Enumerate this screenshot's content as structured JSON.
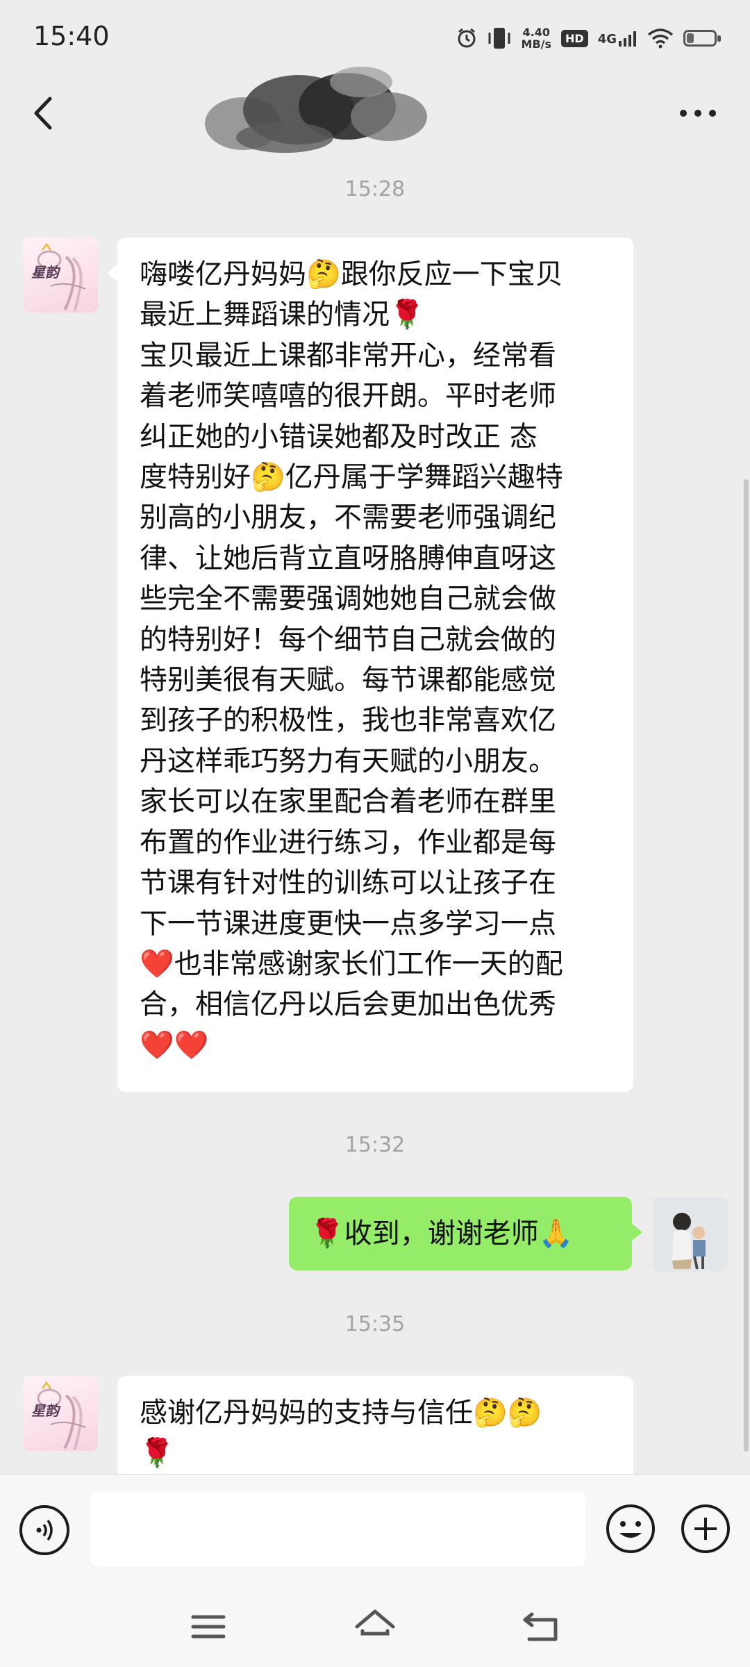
{
  "status_bar": {
    "time": "15:40",
    "net_speed_value": "4.40",
    "net_speed_unit": "MB/s",
    "hd_badge": "HD",
    "network_type": "4G",
    "battery_level_percent": 25
  },
  "header": {
    "contact_name_redacted": true,
    "back_icon": "chevron-left-icon",
    "more_icon": "more-dots-icon"
  },
  "messages": [
    {
      "type": "timestamp",
      "text": "15:28"
    },
    {
      "type": "incoming",
      "avatar": "xingyun-logo-avatar",
      "text": "嗨喽亿丹妈妈🤔跟你反应一下宝贝\n最近上舞蹈课的情况🌹\n宝贝最近上课都非常开心，经常看\n着老师笑嘻嘻的很开朗。平时老师\n纠正她的小错误她都及时改正 态\n度特别好🤔亿丹属于学舞蹈兴趣特\n别高的小朋友，不需要老师强调纪\n律、让她后背立直呀胳膊伸直呀这\n些完全不需要强调她她自己就会做\n的特别好！每个细节自己就会做的\n特别美很有天赋。每节课都能感觉\n到孩子的积极性，我也非常喜欢亿\n丹这样乖巧努力有天赋的小朋友。\n家长可以在家里配合着老师在群里\n布置的作业进行练习，作业都是每\n节课有针对性的训练可以让孩子在\n下一节课进度更快一点多学习一点\n❤️也非常感谢家长们工作一天的配\n合，相信亿丹以后会更加出色优秀\n❤️❤️"
    },
    {
      "type": "timestamp",
      "text": "15:32"
    },
    {
      "type": "outgoing",
      "avatar": "mother-child-photo-avatar",
      "text": "🌹收到，谢谢老师🙏"
    },
    {
      "type": "timestamp",
      "text": "15:35"
    },
    {
      "type": "incoming",
      "avatar": "xingyun-logo-avatar",
      "text": "感谢亿丹妈妈的支持与信任🤔🤔\n🌹"
    }
  ],
  "avatar_logo_text": "星韵",
  "input_bar": {
    "voice_icon": "voice-icon",
    "placeholder": "",
    "emoji_icon": "emoji-icon",
    "plus_icon": "plus-icon"
  },
  "nav_bar": {
    "icons": [
      "menu-icon",
      "home-icon",
      "back-icon"
    ]
  },
  "colors": {
    "background": "#ededed",
    "outgoing_bubble": "#95ec69",
    "incoming_bubble": "#ffffff",
    "timestamp": "#a3a3a3"
  }
}
